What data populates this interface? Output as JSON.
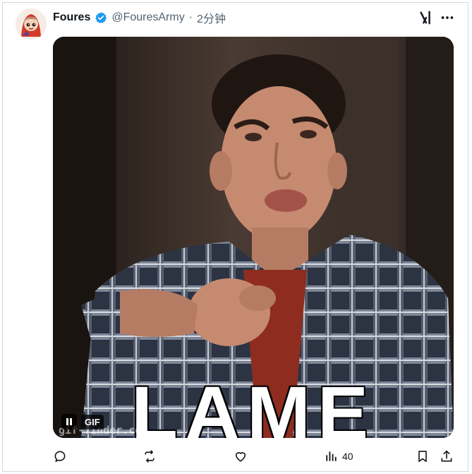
{
  "tweet": {
    "author": {
      "display_name": "Foures",
      "handle": "@FouresArmy",
      "verified": true
    },
    "separator": "·",
    "time": "2分钟",
    "media": {
      "type": "GIF",
      "caption": "LAME",
      "watermark": "gif-finder.com",
      "badge": "GIF"
    },
    "actions": {
      "views_count": "40"
    }
  },
  "icons": {
    "reply": "reply-icon",
    "repost": "repost-icon",
    "like": "like-icon",
    "views": "views-icon",
    "bookmark": "bookmark-icon",
    "share": "share-icon",
    "grok": "x-logo-icon",
    "more": "more-icon",
    "verified": "verified-badge-icon",
    "pause": "pause-icon"
  },
  "colors": {
    "verified_blue": "#1d9bf0",
    "secondary_text": "#536471",
    "primary_text": "#0f1419"
  }
}
